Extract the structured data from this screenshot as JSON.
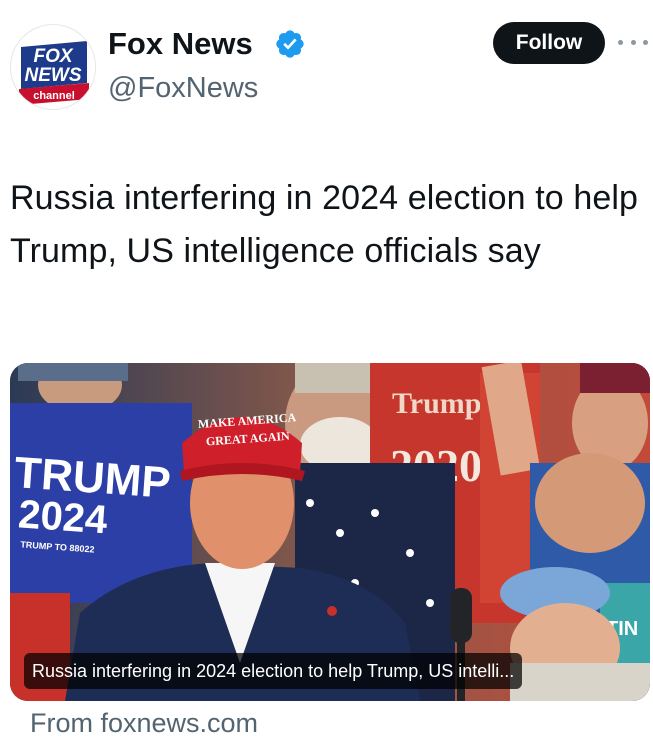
{
  "author": {
    "name": "Fox News",
    "handle": "@FoxNews",
    "verified": true,
    "avatar": {
      "logo_lines": [
        "FOX",
        "NEWS",
        "channel"
      ],
      "colors": {
        "blue": "#1e3a8a",
        "red": "#c8102e"
      }
    }
  },
  "actions": {
    "follow_label": "Follow",
    "more_icon": "more-horizontal-icon"
  },
  "tweet": {
    "text": "Russia interfering in 2024 election to help Trump, US intelligence officials say"
  },
  "card": {
    "caption": "Russia interfering in 2024 election to help Trump, US intelli...",
    "image_text": {
      "hat_line1": "MAKE AMERICA",
      "hat_line2": "GREAT AGAIN",
      "sign_left_line1": "TRUMP",
      "sign_left_line2": "2024",
      "sign_left_small": "TRUMP TO 88022",
      "sign_right_line1": "Trump",
      "sign_right_line2": "2020",
      "sign_far_right": "TIN"
    },
    "source": "From foxnews.com"
  },
  "colors": {
    "text": "#0f1419",
    "secondary": "#536471",
    "verified": "#1d9bf0",
    "button_bg": "#0f1419"
  }
}
